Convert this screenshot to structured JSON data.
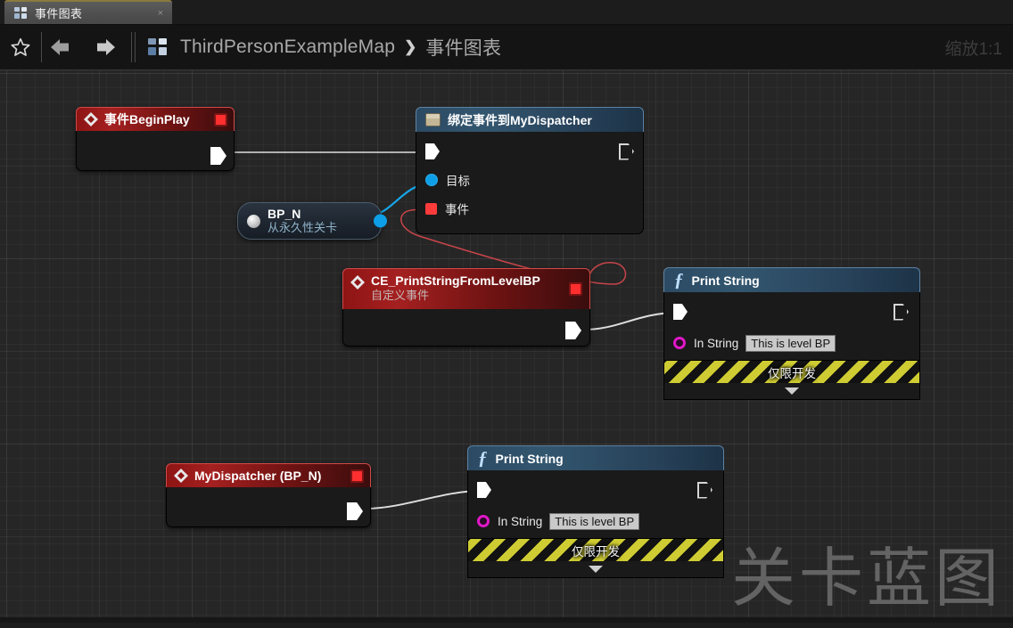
{
  "tab": {
    "icon": "grid-icon",
    "label": "事件图表",
    "close": "×"
  },
  "toolbar": {
    "favorite_icon": "star-icon",
    "back_icon": "arrow-left-icon",
    "forward_icon": "arrow-right-icon",
    "breadcrumb_icon": "blueprint-grid-icon",
    "breadcrumb_root": "ThirdPersonExampleMap",
    "breadcrumb_separator": "❯",
    "breadcrumb_leaf": "事件图表",
    "zoom_label": "缩放1:1"
  },
  "graph": {
    "watermark": "关卡蓝图",
    "colors": {
      "background": "#262626",
      "exec_wire": "#dedede",
      "object_wire": "#17a6e8",
      "delegate_wire": "#c8454a",
      "event_header": "#8e1414",
      "function_header": "#2c4a63",
      "dev_only_stripe": "#cfcc33"
    },
    "nodes": [
      {
        "id": "event-begin-play",
        "kind": "event",
        "title": "事件BeginPlay",
        "subtitle": "",
        "icon": "event-diamond-icon",
        "corner_icon": "red-square-icon",
        "pins": {
          "exec_out": ""
        }
      },
      {
        "id": "bind-event-to-mydispatcher",
        "kind": "function",
        "title": "绑定事件到MyDispatcher",
        "icon": "delegate-box-icon",
        "pins": {
          "exec_in": "",
          "exec_out": "",
          "target_label": "目标",
          "event_label": "事件"
        }
      },
      {
        "id": "bp-n-variable",
        "kind": "variable",
        "title": "BP_N",
        "subtitle": "从永久性关卡",
        "icon": "object-orb-icon"
      },
      {
        "id": "ce-print-string-from-level-bp",
        "kind": "event",
        "title": "CE_PrintStringFromLevelBP",
        "subtitle": "自定义事件",
        "icon": "event-diamond-icon",
        "corner_icon": "red-square-icon"
      },
      {
        "id": "print-string-1",
        "kind": "function",
        "title": "Print String",
        "icon": "function-f-icon",
        "pins": {
          "in_string_label": "In String",
          "in_string_value": "This is level BP"
        },
        "footer": {
          "label": "仅限开发",
          "collapse_icon": "chevron-down-icon"
        }
      },
      {
        "id": "mydispatcher-bp-n",
        "kind": "event",
        "title": "MyDispatcher (BP_N)",
        "subtitle": "",
        "icon": "event-diamond-icon",
        "corner_icon": "red-square-icon"
      },
      {
        "id": "print-string-2",
        "kind": "function",
        "title": "Print String",
        "icon": "function-f-icon",
        "pins": {
          "in_string_label": "In String",
          "in_string_value": "This is level BP"
        },
        "footer": {
          "label": "仅限开发",
          "collapse_icon": "chevron-down-icon"
        }
      }
    ]
  }
}
